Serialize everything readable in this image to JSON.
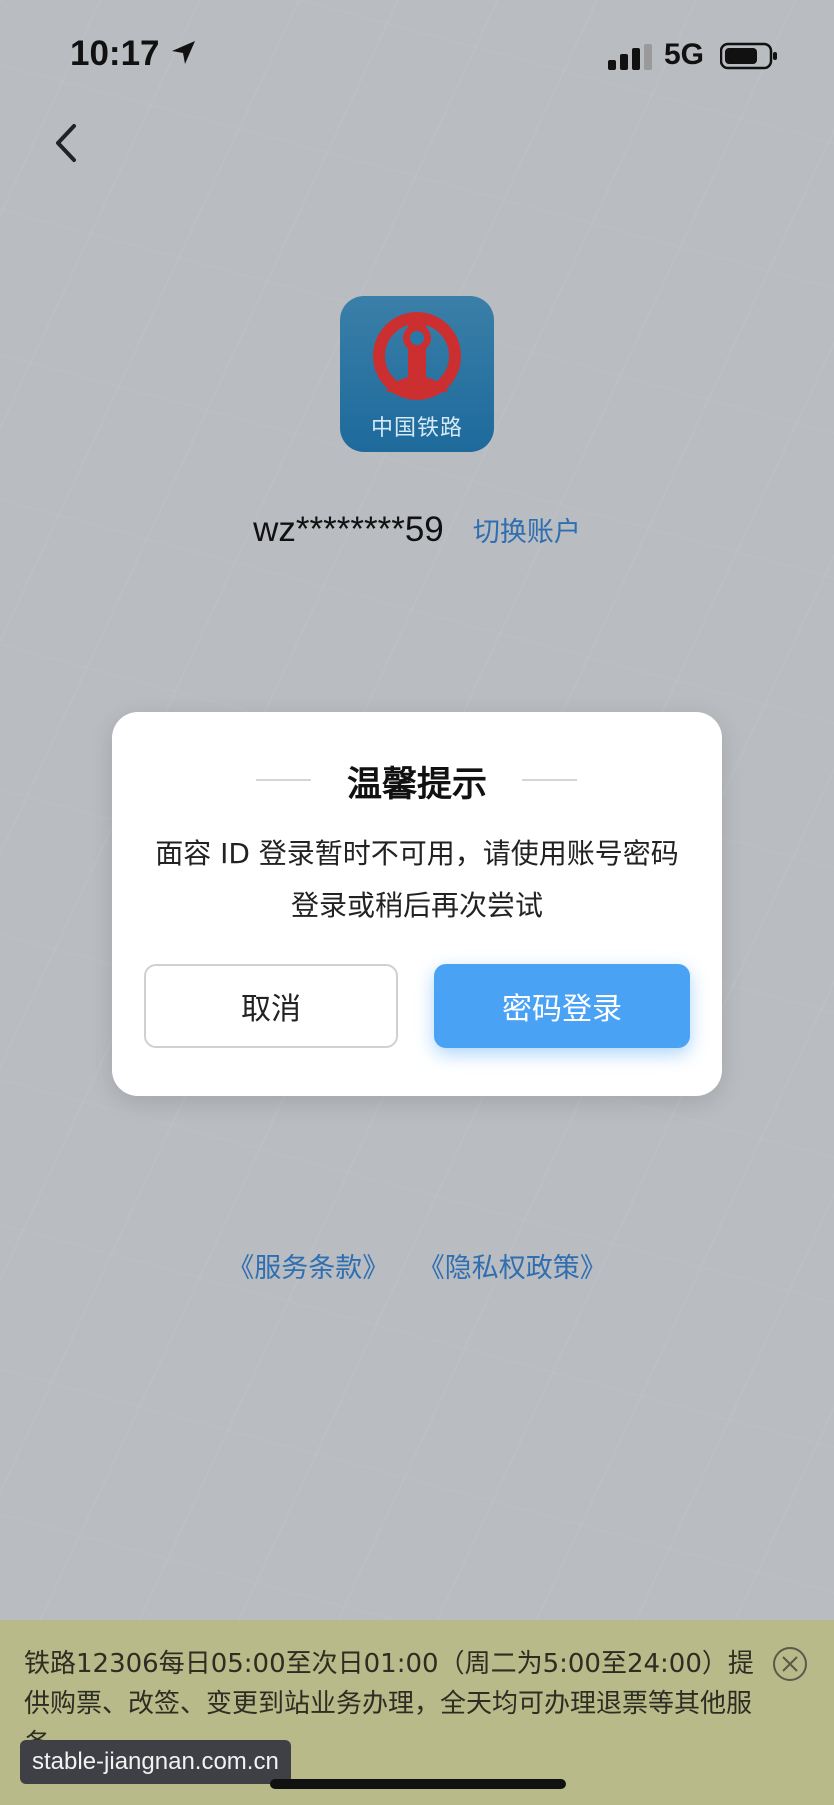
{
  "status_bar": {
    "time": "10:17",
    "network": "5G",
    "icons": [
      "location-arrow-icon",
      "signal-icon",
      "battery-icon"
    ]
  },
  "navigation": {
    "back_icon": "chevron-left-icon"
  },
  "app": {
    "logo_text": "中国铁路"
  },
  "account": {
    "name": "wz********59",
    "switch_label": "切换账户"
  },
  "dialog": {
    "title": "温馨提示",
    "message": "面容 ID 登录暂时不可用，请使用账号密码登录或稍后再次尝试",
    "cancel_label": "取消",
    "confirm_label": "密码登录"
  },
  "links": {
    "terms": "《服务条款》",
    "privacy": "《隐私权政策》"
  },
  "notice": {
    "text": "铁路12306每日05:00至次日01:00（周二为5:00至24:00）提供购票、改签、变更到站业务办理，全天均可办理退票等其他服务。",
    "close_icon": "close-circle-icon"
  },
  "watermark": {
    "text": "stable-jiangnan.com.cn"
  },
  "colors": {
    "accent": "#4aa2f5",
    "link": "#2f6fb1",
    "overlay": "#b9bcc1",
    "notice_bg": "#b8ba8a"
  }
}
